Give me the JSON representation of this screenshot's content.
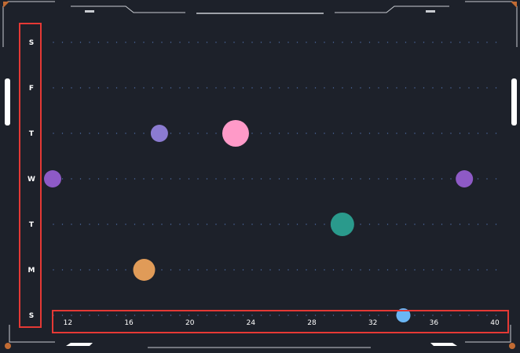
{
  "chart_data": {
    "type": "scatter",
    "title": "",
    "xlabel": "",
    "ylabel": "",
    "x_ticks": [
      12,
      16,
      20,
      24,
      28,
      32,
      36,
      40
    ],
    "xlim": [
      11,
      40
    ],
    "y_categories": [
      "S",
      "M",
      "T",
      "W",
      "T",
      "F",
      "S"
    ],
    "grid": true,
    "points": [
      {
        "x": 11,
        "y": 3,
        "size": 11,
        "color": "#8e5ac6"
      },
      {
        "x": 17,
        "y": 1,
        "size": 14,
        "color": "#e09b58"
      },
      {
        "x": 18,
        "y": 4,
        "size": 11,
        "color": "#8b7bd1"
      },
      {
        "x": 23,
        "y": 4,
        "size": 17,
        "color": "#ff9ac8"
      },
      {
        "x": 30,
        "y": 2,
        "size": 15,
        "color": "#2a9a8c"
      },
      {
        "x": 34,
        "y": 0,
        "size": 9,
        "color": "#6ab6f5"
      },
      {
        "x": 38,
        "y": 3,
        "size": 11,
        "color": "#8e5ac6"
      }
    ]
  },
  "colors": {
    "background": "#1d212a",
    "frame": "#c9ccd2",
    "accent_orange": "#c26b33",
    "grid_dot": "#4e6aa3",
    "highlight": "#e53935"
  }
}
